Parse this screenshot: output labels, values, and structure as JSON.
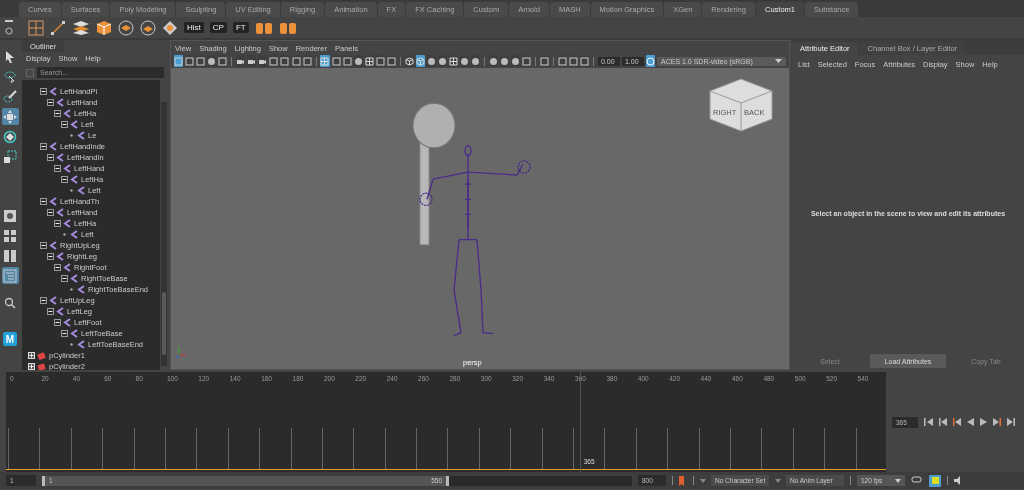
{
  "shelf_tabs": [
    {
      "label": "Curves",
      "selected": false
    },
    {
      "label": "Surfaces",
      "selected": false
    },
    {
      "label": "Poly Modeling",
      "selected": false
    },
    {
      "label": "Sculpting",
      "selected": false
    },
    {
      "label": "UV Editing",
      "selected": false
    },
    {
      "label": "Rigging",
      "selected": false
    },
    {
      "label": "Animation",
      "selected": false
    },
    {
      "label": "FX",
      "selected": false
    },
    {
      "label": "FX Caching",
      "selected": false
    },
    {
      "label": "Custom",
      "selected": false
    },
    {
      "label": "Arnold",
      "selected": false
    },
    {
      "label": "MASH",
      "selected": false
    },
    {
      "label": "Motion Graphics",
      "selected": false
    },
    {
      "label": "XGen",
      "selected": false
    },
    {
      "label": "Rendering",
      "selected": false
    },
    {
      "label": "Custom1",
      "selected": true
    },
    {
      "label": "Substance",
      "selected": false
    }
  ],
  "shelf_labels": [
    "Hist",
    "CP",
    "FT"
  ],
  "tools": [
    {
      "kind": "select",
      "selected": false
    },
    {
      "kind": "lasso",
      "selected": false
    },
    {
      "kind": "paint",
      "selected": false
    },
    {
      "kind": "move",
      "selected": true
    },
    {
      "kind": "rotate",
      "selected": false
    },
    {
      "kind": "scale",
      "selected": false
    }
  ],
  "layouts": [
    {
      "kind": "single",
      "selected": false
    },
    {
      "kind": "four",
      "selected": false
    },
    {
      "kind": "two",
      "selected": false
    },
    {
      "kind": "outliner",
      "selected": true
    }
  ],
  "logo_letter": "M",
  "outliner": {
    "tab": "Outliner",
    "menu": [
      "Display",
      "Show",
      "Help"
    ],
    "search_placeholder": "Search...",
    "tree": [
      {
        "label": "LeftHandPi",
        "kind": "joint",
        "expanded": true,
        "children": [
          {
            "label": "LeftHand",
            "kind": "joint",
            "expanded": true,
            "children": [
              {
                "label": "LeftHa",
                "kind": "joint",
                "expanded": true,
                "children": [
                  {
                    "label": "Left",
                    "kind": "joint",
                    "expanded": true,
                    "children": [
                      {
                        "label": "Le",
                        "kind": "joint"
                      }
                    ]
                  }
                ]
              }
            ]
          }
        ]
      },
      {
        "label": "LeftHandInde",
        "kind": "joint",
        "expanded": true,
        "children": [
          {
            "label": "LeftHandIn",
            "kind": "joint",
            "expanded": true,
            "children": [
              {
                "label": "LeftHand",
                "kind": "joint",
                "expanded": true,
                "children": [
                  {
                    "label": "LeftHa",
                    "kind": "joint",
                    "expanded": true,
                    "children": [
                      {
                        "label": "Left",
                        "kind": "joint"
                      }
                    ]
                  }
                ]
              }
            ]
          }
        ]
      },
      {
        "label": "LeftHandTh",
        "kind": "joint",
        "expanded": true,
        "children": [
          {
            "label": "LeftHand",
            "kind": "joint",
            "expanded": true,
            "children": [
              {
                "label": "LeftHa",
                "kind": "joint",
                "expanded": true,
                "children": [
                  {
                    "label": "Left",
                    "kind": "joint"
                  }
                ]
              }
            ]
          }
        ]
      },
      {
        "label": "RightUpLeg",
        "kind": "joint",
        "expanded": true,
        "children": [
          {
            "label": "RightLeg",
            "kind": "joint",
            "expanded": true,
            "children": [
              {
                "label": "RightFoot",
                "kind": "joint",
                "expanded": true,
                "children": [
                  {
                    "label": "RightToeBase",
                    "kind": "joint",
                    "expanded": true,
                    "children": [
                      {
                        "label": "RightToeBaseEnd",
                        "kind": "joint"
                      }
                    ]
                  }
                ]
              }
            ]
          }
        ]
      },
      {
        "label": "LeftUpLeg",
        "kind": "joint",
        "expanded": true,
        "children": [
          {
            "label": "LeftLeg",
            "kind": "joint",
            "expanded": true,
            "children": [
              {
                "label": "LeftFoot",
                "kind": "joint",
                "expanded": true,
                "children": [
                  {
                    "label": "LeftToeBase",
                    "kind": "joint",
                    "expanded": true,
                    "children": [
                      {
                        "label": "LeftToeBaseEnd",
                        "kind": "joint"
                      }
                    ]
                  }
                ]
              }
            ]
          }
        ]
      },
      {
        "label": "pCylinder1",
        "kind": "mesh",
        "expanded": false
      },
      {
        "label": "pCylinder2",
        "kind": "mesh",
        "expanded": false
      }
    ]
  },
  "viewport": {
    "menu": [
      "View",
      "Shading",
      "Lighting",
      "Show",
      "Renderer",
      "Panels"
    ],
    "toolbar": [
      {
        "kind": "box",
        "selected": true
      },
      {
        "kind": "box",
        "selected": false
      },
      {
        "kind": "box",
        "selected": false
      },
      {
        "kind": "circle",
        "selected": false
      },
      {
        "kind": "box",
        "selected": false
      },
      {
        "kind": "sep"
      },
      {
        "kind": "camera",
        "selected": false
      },
      {
        "kind": "camera",
        "selected": false
      },
      {
        "kind": "camera",
        "selected": false
      },
      {
        "kind": "box",
        "selected": false
      },
      {
        "kind": "box",
        "selected": false
      },
      {
        "kind": "box",
        "selected": false
      },
      {
        "kind": "box",
        "selected": false
      },
      {
        "kind": "sep"
      },
      {
        "kind": "grid",
        "selected": true
      },
      {
        "kind": "box",
        "selected": false
      },
      {
        "kind": "box",
        "selected": false
      },
      {
        "kind": "circle",
        "selected": false
      },
      {
        "kind": "grid",
        "selected": false
      },
      {
        "kind": "box",
        "selected": false
      },
      {
        "kind": "box",
        "selected": false
      },
      {
        "kind": "sep"
      },
      {
        "kind": "cube",
        "selected": false
      },
      {
        "kind": "cube",
        "selected": true
      },
      {
        "kind": "circle",
        "selected": false
      },
      {
        "kind": "circle",
        "selected": false
      },
      {
        "kind": "grid",
        "selected": false
      },
      {
        "kind": "circle",
        "selected": false
      },
      {
        "kind": "circle",
        "selected": false
      },
      {
        "kind": "sep"
      },
      {
        "kind": "circle",
        "selected": false
      },
      {
        "kind": "circle",
        "selected": false
      },
      {
        "kind": "circle",
        "selected": false
      },
      {
        "kind": "box",
        "selected": false
      },
      {
        "kind": "sep"
      },
      {
        "kind": "box",
        "selected": false
      },
      {
        "kind": "sep"
      },
      {
        "kind": "box",
        "selected": false
      },
      {
        "kind": "box",
        "selected": false
      },
      {
        "kind": "box",
        "selected": false
      }
    ],
    "exposure": "0.00",
    "gamma": "1.00",
    "color_space": "ACES 1.0 SDR-video (sRGB)",
    "cube_faces": [
      "RIGHT",
      "BACK"
    ],
    "camera": "persp"
  },
  "attribute_editor": {
    "tabs": [
      {
        "label": "Attribute Editor",
        "selected": true
      },
      {
        "label": "Channel Box / Layer Editor",
        "selected": false
      }
    ],
    "menu": [
      "List",
      "Selected",
      "Focus",
      "Attributes",
      "Display",
      "Show",
      "Help"
    ],
    "message": "Select an object in the scene to view and edit its attributes",
    "buttons": [
      {
        "label": "Select",
        "disabled": true
      },
      {
        "label": "Load Attributes",
        "disabled": false
      },
      {
        "label": "Copy Tab",
        "disabled": true
      }
    ]
  },
  "timeline": {
    "ticks": [
      "0",
      "20",
      "40",
      "60",
      "80",
      "100",
      "120",
      "140",
      "160",
      "180",
      "200",
      "220",
      "240",
      "260",
      "280",
      "300",
      "320",
      "340",
      "360",
      "380",
      "400",
      "420",
      "440",
      "460",
      "480",
      "500",
      "520",
      "540"
    ],
    "current_frame": "365",
    "playhead": {
      "level": 0.652
    },
    "frame_field": "365"
  },
  "range": {
    "start_field": "1",
    "slider_start": "1",
    "slider_end": "550",
    "level": 0.69,
    "end_field": "800",
    "character_set": "No Character Set",
    "anim_layer": "No Anim Layer",
    "fps": "120 fps"
  }
}
